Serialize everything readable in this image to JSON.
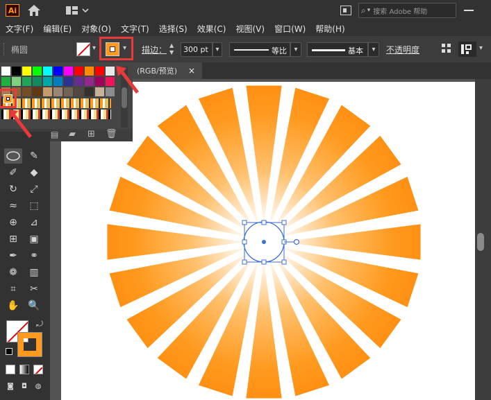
{
  "app": {
    "logo": "Ai",
    "search_placeholder": "搜索 Adobe 帮助"
  },
  "menu": [
    "文字(F)",
    "编辑(E)",
    "对象(O)",
    "文字(T)",
    "选择(S)",
    "效果(C)",
    "视图(V)",
    "窗口(W)",
    "帮助(H)"
  ],
  "control": {
    "shape_label": "椭圆",
    "stroke_label": "描边：",
    "stroke_value": "300 pt",
    "profile1": "等比",
    "profile2": "基本",
    "opacity_label": "不透明度"
  },
  "document": {
    "tab_label": "(RGB/预览)",
    "close": "×"
  },
  "colors": {
    "accent_orange": "#ff9a1f",
    "highlight_red": "#e83a3a",
    "selection_blue": "#3a6fd8"
  },
  "swatches_row1": [
    "#ffffff",
    "#000000",
    "#ffff00",
    "#00ff00",
    "#00ffff",
    "#0000ff",
    "#ff00ff",
    "#ff0000",
    "#ff8a00",
    "#ff0000",
    "#e8e8e8"
  ],
  "swatches_row2": [
    "#20b040",
    "#7fd17f",
    "#22a35a",
    "#13895f",
    "#00a7a7",
    "#007fbf",
    "#2e3192",
    "#662d91",
    "#92278f",
    "#9e005d",
    "#ed145b"
  ],
  "swatches_row3": [
    "#a67c52",
    "#8c6239",
    "#754c24",
    "#603913",
    "#c69c6d",
    "#998675",
    "#736357",
    "#534741",
    "#362f2d",
    "#c7b299",
    "#8c8c8c"
  ]
}
